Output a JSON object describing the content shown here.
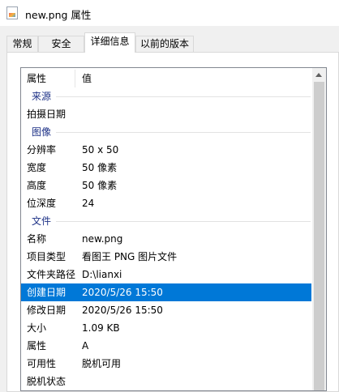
{
  "window": {
    "title": "new.png 属性",
    "icon": "png-file-icon"
  },
  "tabs": [
    {
      "label": "常规",
      "active": false
    },
    {
      "label": "安全",
      "active": false
    },
    {
      "label": "详细信息",
      "active": true
    },
    {
      "label": "以前的版本",
      "active": false
    }
  ],
  "list": {
    "header": {
      "property": "属性",
      "value": "值"
    },
    "groups": {
      "origin": "来源",
      "image": "图像",
      "file": "文件"
    },
    "rows": {
      "date_taken": {
        "key": "拍摄日期",
        "value": ""
      },
      "dimensions": {
        "key": "分辨率",
        "value": "50 x 50"
      },
      "width": {
        "key": "宽度",
        "value": "50 像素"
      },
      "height": {
        "key": "高度",
        "value": "50 像素"
      },
      "bit_depth": {
        "key": "位深度",
        "value": "24"
      },
      "name": {
        "key": "名称",
        "value": "new.png"
      },
      "item_type": {
        "key": "项目类型",
        "value": "看图王 PNG 图片文件"
      },
      "folder_path": {
        "key": "文件夹路径",
        "value": "D:\\lianxi"
      },
      "date_created": {
        "key": "创建日期",
        "value": "2020/5/26 15:50"
      },
      "date_modified": {
        "key": "修改日期",
        "value": "2020/5/26 15:50"
      },
      "size": {
        "key": "大小",
        "value": "1.09 KB"
      },
      "attributes": {
        "key": "属性",
        "value": "A"
      },
      "availability": {
        "key": "可用性",
        "value": "脱机可用"
      },
      "offline_status": {
        "key": "脱机状态",
        "value": ""
      }
    }
  }
}
